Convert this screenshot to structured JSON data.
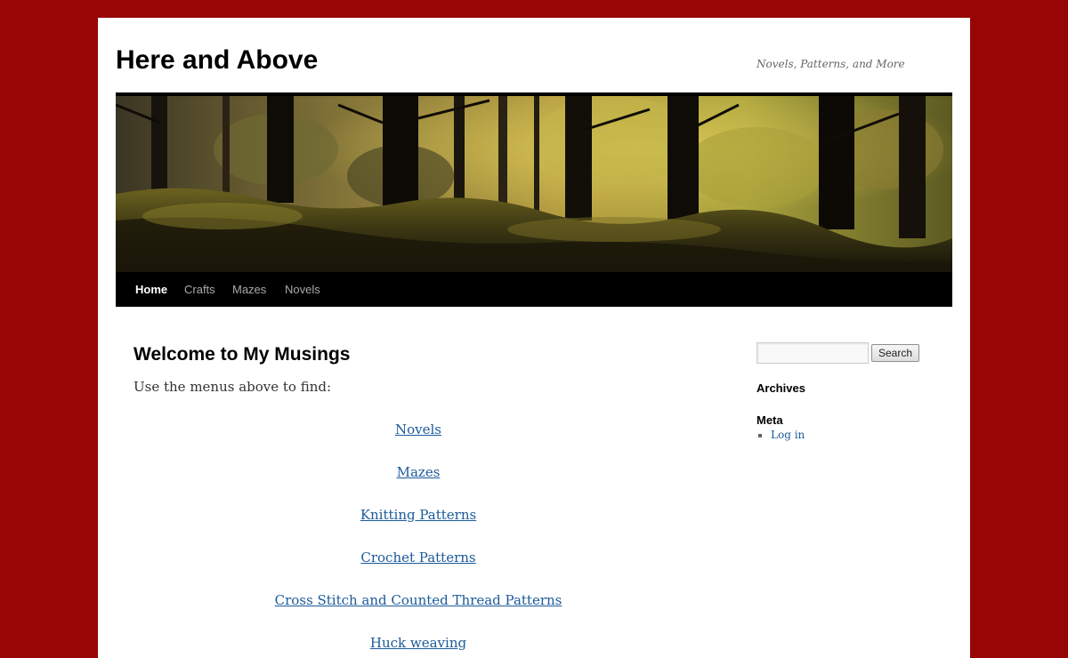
{
  "site": {
    "title": "Here and Above",
    "description": "Novels, Patterns, and More"
  },
  "nav": [
    {
      "label": "Home",
      "active": true
    },
    {
      "label": "Crafts",
      "active": false
    },
    {
      "label": "Mazes",
      "active": false
    },
    {
      "label": "Novels",
      "active": false
    }
  ],
  "post": {
    "title": "Welcome to My Musings",
    "intro": "Use the menus above to find:",
    "links": [
      "Novels",
      "Mazes",
      "Knitting Patterns",
      "Crochet Patterns",
      "Cross Stitch and Counted Thread Patterns",
      "Huck weaving"
    ]
  },
  "sidebar": {
    "search": {
      "value": "",
      "button_label": "Search"
    },
    "archives_title": "Archives",
    "meta_title": "Meta",
    "meta_items": [
      "Log in"
    ]
  },
  "colors": {
    "background": "#970505",
    "link": "#1b5a9a",
    "nav_bar": "#000000"
  },
  "header_image": {
    "icon": "forest-moss-photo"
  }
}
